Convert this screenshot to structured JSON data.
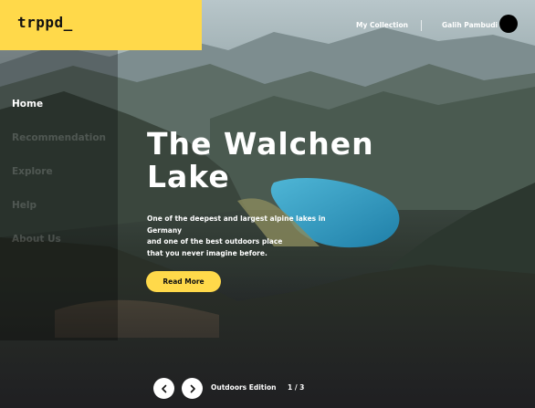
{
  "brand": {
    "logo_text": "trppd_",
    "accent_color": "#ffd94a"
  },
  "header": {
    "links": [
      "My Collection"
    ],
    "user_name": "Galih Pambudi",
    "avatar_icon": "user-avatar-icon"
  },
  "sidebar": {
    "items": [
      {
        "label": "Home",
        "active": true
      },
      {
        "label": "Recommendation",
        "active": false
      },
      {
        "label": "Explore",
        "active": false
      },
      {
        "label": "Help",
        "active": false
      },
      {
        "label": "About Us",
        "active": false
      }
    ]
  },
  "hero": {
    "title_line1": "The Walchen",
    "title_line2": "Lake",
    "description": [
      "One of the deepest and largest alpine lakes in Germany",
      "and one of the best outdoors place",
      "that you never imagine before."
    ],
    "cta_label": "Read More"
  },
  "carousel": {
    "prev_icon": "chevron-left-icon",
    "next_icon": "chevron-right-icon",
    "edition_label": "Outdoors Edition",
    "page_indicator": "1 / 3"
  }
}
